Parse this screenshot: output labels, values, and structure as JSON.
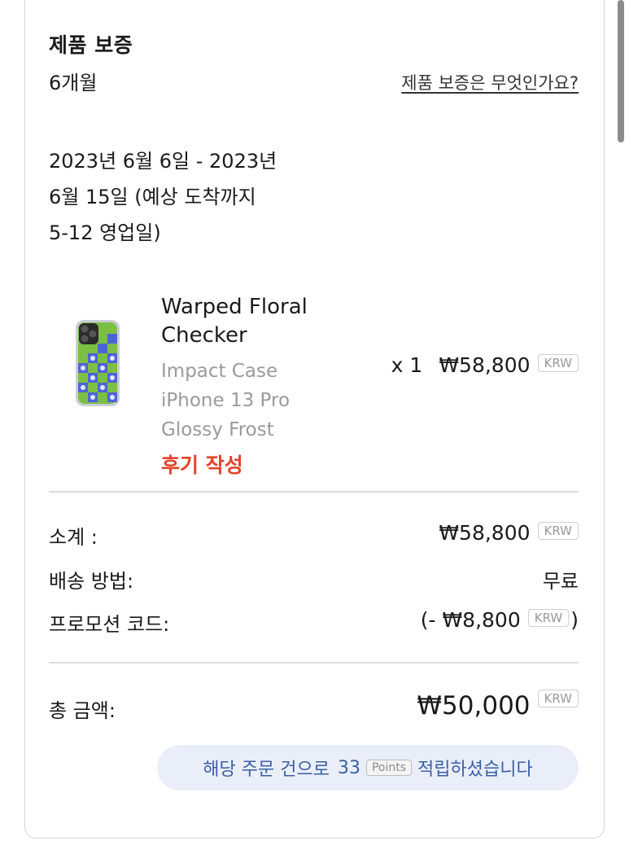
{
  "warranty": {
    "title": "제품 보증",
    "period": "6개월",
    "link_label": "제품 보증은 무엇인가요?"
  },
  "delivery": {
    "estimate_line1": "2023년 6월 6일 - 2023년",
    "estimate_line2": "6월 15일 (예상 도착까지",
    "estimate_line3": "5-12 영업일)"
  },
  "product": {
    "name_line1": "Warped Floral",
    "name_line2": "Checker",
    "variant_type": "Impact Case",
    "variant_model": "iPhone 13 Pro",
    "variant_finish": "Glossy Frost",
    "review_label": "후기 작성",
    "quantity": "x 1",
    "price": "₩58,800",
    "currency": "KRW",
    "image_colors": {
      "green": "#7cc043",
      "blue": "#4f63d9",
      "frame": "#c9cdd6"
    }
  },
  "summary": {
    "subtotal_label": "소계 :",
    "subtotal_value": "₩58,800",
    "subtotal_currency": "KRW",
    "shipping_label": "배송 방법:",
    "shipping_value": "무료",
    "promo_label": "프로모션 코드:",
    "promo_prefix": "(- ₩8,800",
    "promo_currency": "KRW",
    "promo_suffix": ")",
    "total_label": "총 금액:",
    "total_value": "₩50,000",
    "total_currency": "KRW"
  },
  "points": {
    "prefix": "해당 주문 건으로",
    "amount": "33",
    "unit": "Points",
    "suffix": "적립하셨습니다"
  },
  "colors": {
    "accent_red": "#e5432b",
    "points_text": "#3a5fa8",
    "points_bg": "#eaeef8"
  }
}
